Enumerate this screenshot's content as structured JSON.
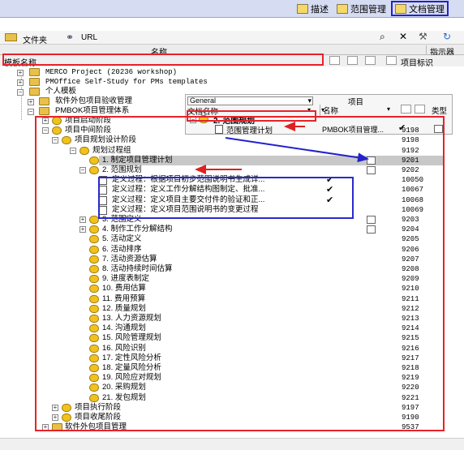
{
  "tabs": [
    {
      "label": "描述"
    },
    {
      "label": "范围管理"
    },
    {
      "label": "文档管理"
    }
  ],
  "toolbar": {
    "folder_label": "文件夹",
    "url_label": "URL"
  },
  "header": {
    "name_col": "名称",
    "indicator_col": "指示器"
  },
  "template_bar": {
    "label": "模板名称",
    "item_id_label": "项目标识"
  },
  "top_items": [
    {
      "label": "MERCO Project (20236 workshop)",
      "mono": true
    },
    {
      "label": "PMOffice Self-Study for PMs templates",
      "mono": true
    },
    {
      "label": "个人模板",
      "mono": false
    },
    {
      "label": "软件外包项目验收管理",
      "mono": false
    },
    {
      "label": "PMBOK项目管理体系",
      "mono": false
    }
  ],
  "popup": {
    "filter_value": "General",
    "project_label": "项目",
    "doc_name_label": "文档名称",
    "section_label": "2. 范围规划",
    "name_label": "名称",
    "type_label": "类型",
    "doc_item": "范围管理计划",
    "project_value": "PMBOK项目管理..."
  },
  "tree": [
    {
      "label": "项目启动阶段",
      "id": ""
    },
    {
      "label": "项目中间阶段",
      "id": "9198"
    },
    {
      "label": "项目规划设计阶段",
      "id": "9198"
    },
    {
      "label": "规划过程组",
      "id": "9192"
    },
    {
      "label": "1. 制定项目管理计划",
      "id": "9201"
    },
    {
      "label": "2. 范围规划",
      "id": "9202"
    },
    {
      "label": "定义过程：根据项目初步范围说明书生成详...",
      "id": "10050"
    },
    {
      "label": "定义过程：定义工作分解结构图制定、批准...",
      "id": "10067"
    },
    {
      "label": "定义过程：定义项目主要交付件的验证和正...",
      "id": "10068"
    },
    {
      "label": "定义过程：定义项目范围说明书的变更过程",
      "id": "10069"
    },
    {
      "label": "3. 范围定义",
      "id": "9203"
    },
    {
      "label": "4. 制作工作分解结构",
      "id": "9204"
    },
    {
      "label": "5. 活动定义",
      "id": "9205"
    },
    {
      "label": "6. 活动排序",
      "id": "9206"
    },
    {
      "label": "7. 活动资源估算",
      "id": "9207"
    },
    {
      "label": "8. 活动持续时间估算",
      "id": "9208"
    },
    {
      "label": "9. 进度表制定",
      "id": "9209"
    },
    {
      "label": "10. 费用估算",
      "id": "9210"
    },
    {
      "label": "11. 费用预算",
      "id": "9211"
    },
    {
      "label": "12. 质量规划",
      "id": "9212"
    },
    {
      "label": "13. 人力资源规划",
      "id": "9213"
    },
    {
      "label": "14. 沟通规划",
      "id": "9214"
    },
    {
      "label": "15. 风险管理规划",
      "id": "9215"
    },
    {
      "label": "16. 风险识别",
      "id": "9216"
    },
    {
      "label": "17. 定性风险分析",
      "id": "9217"
    },
    {
      "label": "18. 定量风险分析",
      "id": "9218"
    },
    {
      "label": "19. 风险应对规划",
      "id": "9219"
    },
    {
      "label": "20. 采购规划",
      "id": "9220"
    },
    {
      "label": "21. 发包规划",
      "id": "9221"
    },
    {
      "label": "项目执行阶段",
      "id": "9197"
    },
    {
      "label": "项目收尾阶段",
      "id": "9190"
    },
    {
      "label": "软件外包项目管理",
      "id": "9537"
    }
  ]
}
